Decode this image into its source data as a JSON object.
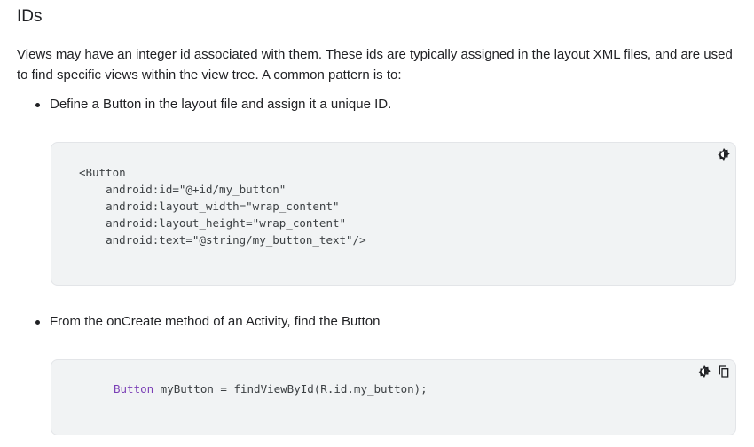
{
  "section": {
    "heading": "IDs",
    "paragraph": "Views may have an integer id associated with them. These ids are typically assigned in the layout XML files, and are used to find specific views within the view tree. A common pattern is to:"
  },
  "steps": [
    {
      "text": "Define a Button in the layout file and assign it a unique ID.",
      "code_lines": [
        "<Button",
        "    android:id=\"@+id/my_button\"",
        "    android:layout_width=\"wrap_content\"",
        "    android:layout_height=\"wrap_content\"",
        "    android:text=\"@string/my_button_text\"/>"
      ],
      "icons": [
        "theme-toggle-icon"
      ]
    },
    {
      "text": "From the onCreate method of an Activity, find the Button",
      "code_keyword": "Button",
      "code_rest": " myButton = findViewById(R.id.my_button);",
      "icons": [
        "theme-toggle-icon",
        "copy-icon"
      ]
    }
  ],
  "colors": {
    "code_background": "#f1f3f4",
    "code_keyword": "#7b3fb6",
    "text": "#202124"
  }
}
